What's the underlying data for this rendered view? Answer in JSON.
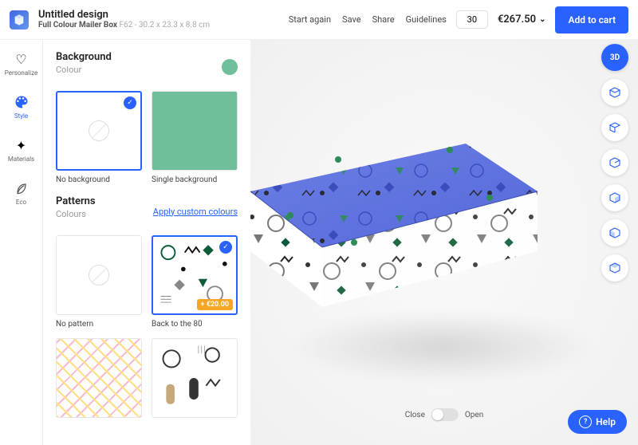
{
  "header": {
    "title": "Untitled design",
    "product": "Full Colour Mailer Box",
    "sku": "F62 - 30.2 x 23.3 x 8.8 cm",
    "links": {
      "start": "Start again",
      "save": "Save",
      "share": "Share",
      "guidelines": "Guidelines"
    },
    "qty": "30",
    "price": "€267.50",
    "add": "Add to cart"
  },
  "nav": {
    "personalize": "Personalize",
    "style": "Style",
    "materials": "Materials",
    "eco": "Eco"
  },
  "panel": {
    "background": {
      "title": "Background",
      "colour_label": "Colour",
      "none": "No background",
      "single": "Single background"
    },
    "patterns": {
      "title": "Patterns",
      "colours": "Colours",
      "apply": "Apply custom colours",
      "none": "No pattern",
      "back80": "Back to the 80",
      "badge": "+ €20.00"
    }
  },
  "canvas": {
    "close": "Close",
    "open": "Open"
  },
  "right": {
    "threeD": "3D"
  },
  "help": "Help"
}
